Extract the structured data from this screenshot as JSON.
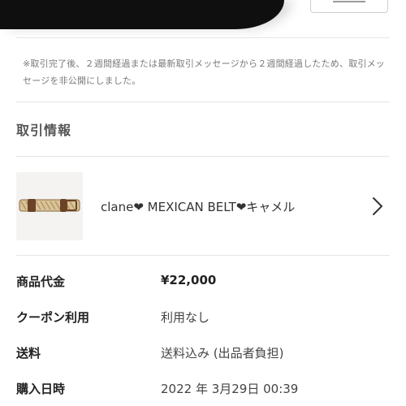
{
  "notice": {
    "text": "※取引完了後、２週間経過または最新取引メッセージから２週間経過したため、取引メッセージを非公開にしました。"
  },
  "section": {
    "title": "取引情報"
  },
  "product": {
    "name": "clane❤ MEXICAN BELT❤キャメル",
    "thumbnail_icon": "belt-image"
  },
  "details": {
    "rows": [
      {
        "label": "商品代金",
        "value": "¥22,000"
      },
      {
        "label": "クーポン利用",
        "value": "利用なし"
      },
      {
        "label": "送料",
        "value": "送料込み (出品者負担)"
      },
      {
        "label": "購入日時",
        "value": "2022 年 3月29日 00:39"
      }
    ]
  },
  "colors": {
    "divider": "#e6e6e6",
    "text_primary": "#222222",
    "text_muted": "#7a7a7a"
  }
}
